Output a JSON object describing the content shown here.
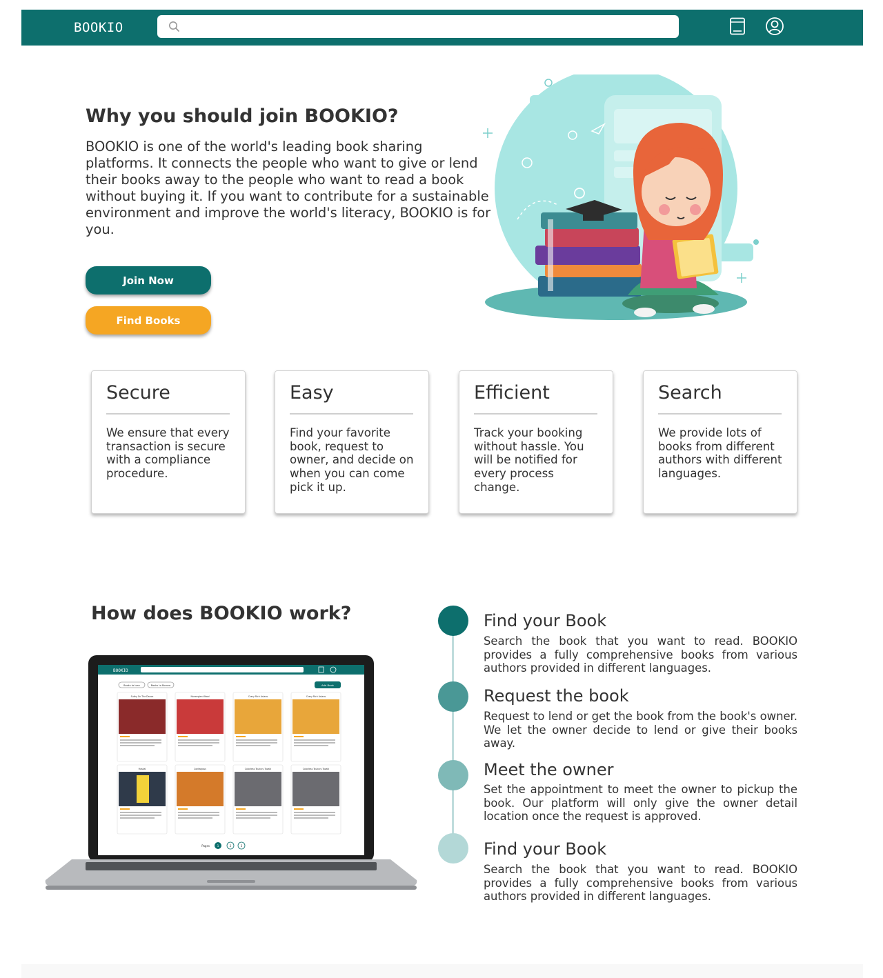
{
  "topbar": {
    "logo": "BOOKIO",
    "search_placeholder": "",
    "icons": [
      "book-icon",
      "user-icon"
    ],
    "color": "#0d6f6d"
  },
  "hero": {
    "title": "Why you should join BOOKIO?",
    "text": "BOOKIO is one of the world's leading book sharing platforms. It connects the people who want to give or lend their books away to the people who want to read a book without buying it. If you want to contribute for a sustainable environment and improve the world's literacy, BOOKIO is for you.",
    "join_label": "Join Now",
    "find_label": "Find Books",
    "join_color": "#0d6f6d",
    "find_color": "#f5a623"
  },
  "features": [
    {
      "title": "Secure",
      "text": "We ensure that every transaction is secure with a compliance procedure."
    },
    {
      "title": "Easy",
      "text": "Find your favorite book, request to owner, and decide on when you can come pick it up."
    },
    {
      "title": "Efficient",
      "text": "Track your booking without hassle. You will be notified for every process change."
    },
    {
      "title": "Search",
      "text": "We provide lots of books from different authors with different languages."
    }
  ],
  "how": {
    "title": "How does BOOKIO work?",
    "steps": [
      {
        "title": "Find your Book",
        "text": "Search the book that you want to read. BOOKIO provides a fully comprehensive books from various authors provided in different languages.",
        "color": "#0d6f6d"
      },
      {
        "title": "Request the book",
        "text": "Request to lend or get the book from the book's owner. We let the owner decide to lend or give their books away.",
        "color": "#4a9896"
      },
      {
        "title": "Meet the owner",
        "text": "Set the appointment to meet the owner to pickup the book. Our platform will only give the owner detail location once the request is approved.",
        "color": "#7fb9b7"
      },
      {
        "title": "Find your Book",
        "text": "Search the book that you want to read. BOOKIO provides a fully comprehensive books from various authors provided in different languages.",
        "color": "#b3d8d7"
      }
    ]
  },
  "laptop_screen": {
    "logo": "BOOKIO",
    "tabs": [
      "Books to loan",
      "Books to Borrow"
    ],
    "add_button": "Add Book",
    "books": [
      "Sufey On The Dance",
      "Norwegian Wood",
      "Crazy Rich Asians",
      "Crazy Rich Asians",
      "Haskal",
      "Contagious",
      "Colorless Tsukuru Tazaki",
      "Colorless Tsukuru Tazaki"
    ],
    "pages_label": "Pages",
    "pages": [
      "1",
      "2",
      "3"
    ]
  }
}
